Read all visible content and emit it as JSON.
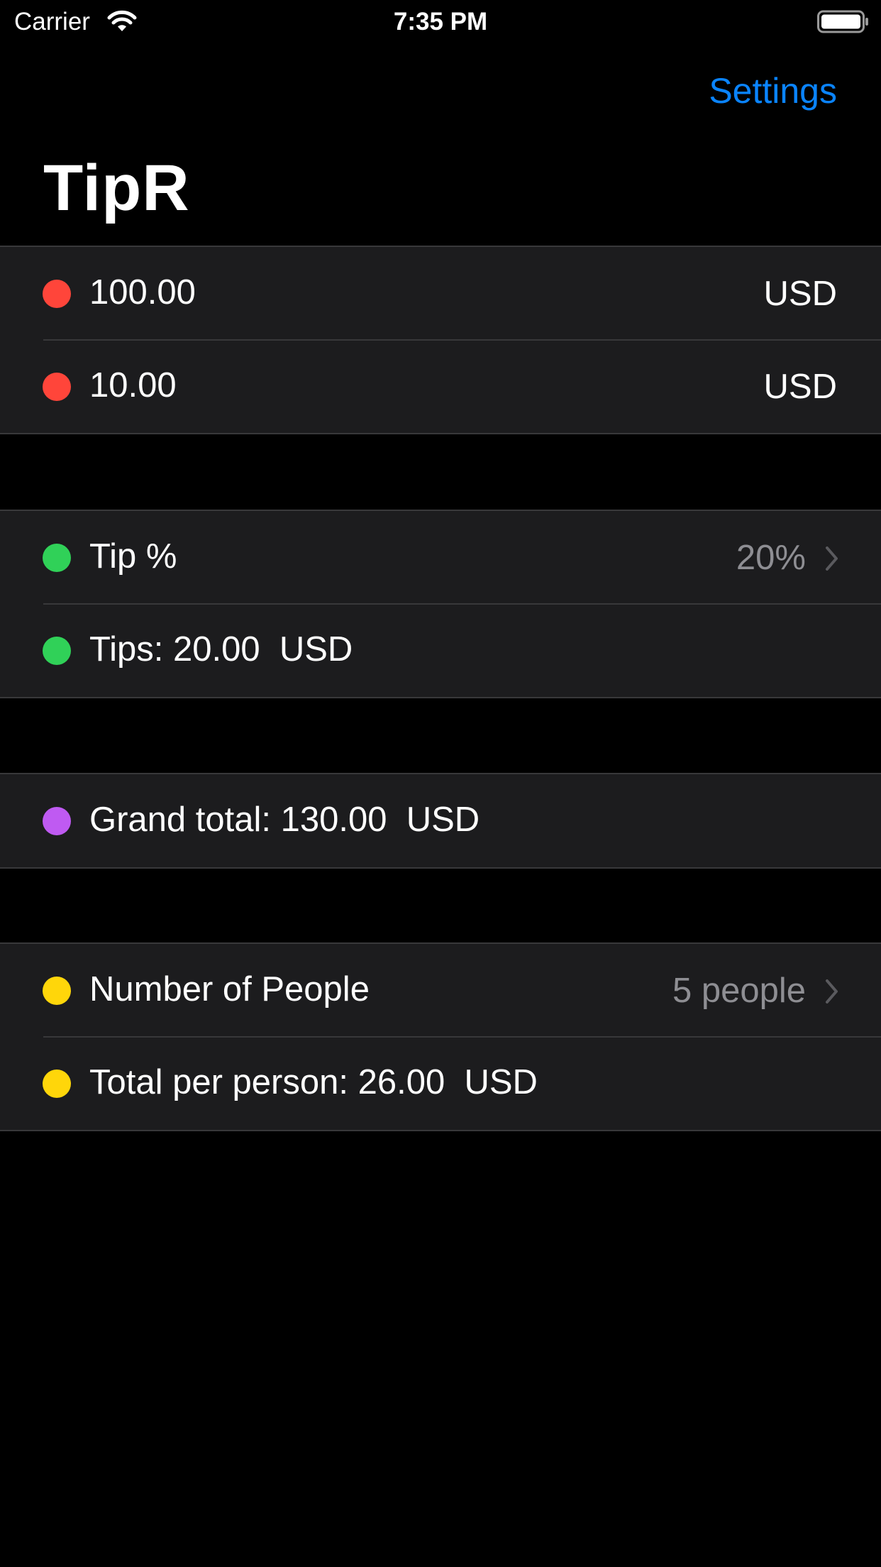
{
  "status_bar": {
    "carrier": "Carrier",
    "time": "7:35 PM",
    "icons": [
      "wifi-icon",
      "battery-icon"
    ]
  },
  "nav": {
    "settings_label": "Settings",
    "title": "TipR"
  },
  "bill_section": {
    "amount_value": "100.00",
    "amount_currency": "USD",
    "tax_value": "10.00",
    "tax_currency": "USD",
    "dot_color": "#ff453a"
  },
  "tip_section": {
    "tip_percent_label": "Tip %",
    "tip_percent_value": "20%",
    "tips_text": "Tips: 20.00  USD",
    "dot_color": "#30d158"
  },
  "total_section": {
    "grand_total_text": "Grand total: 130.00  USD",
    "dot_color": "#bf5af2"
  },
  "people_section": {
    "people_label": "Number of People",
    "people_value": "5 people",
    "per_person_text": "Total per person: 26.00  USD",
    "dot_color": "#ffd60a"
  },
  "colors": {
    "accent": "#0a84ff",
    "cell_background": "#1c1c1e",
    "separator": "#38383a",
    "secondary_text": "#8e8e93"
  }
}
